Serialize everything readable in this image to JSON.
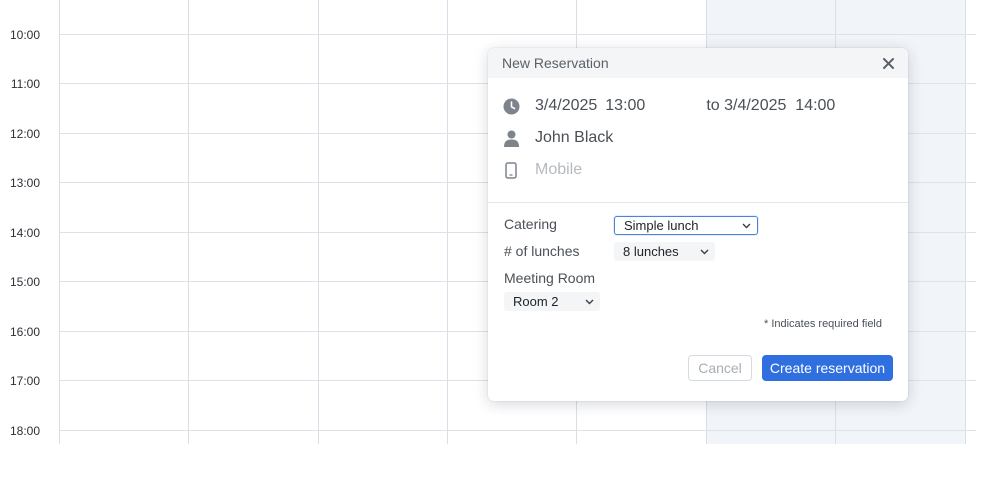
{
  "calendar": {
    "time_labels": [
      "10:00",
      "11:00",
      "12:00",
      "13:00",
      "14:00",
      "15:00",
      "16:00",
      "17:00",
      "18:00"
    ]
  },
  "dialog": {
    "title": "New Reservation",
    "start_date": "3/4/2025",
    "start_time": "13:00",
    "end_text": "to 3/4/2025  14:00",
    "person": "John Black",
    "mobile_placeholder": "Mobile",
    "catering_label": "Catering",
    "catering_value": "Simple lunch",
    "lunches_label": "# of lunches",
    "lunches_value": "8 lunches",
    "meeting_room_label": "Meeting Room",
    "meeting_room_value": "Room 2",
    "required_note": "* Indicates required field",
    "cancel_label": "Cancel",
    "create_label": "Create reservation"
  },
  "colors": {
    "accent": "#2f6fe0",
    "grid_line": "#d9dfe6",
    "weekend_shade": "#f1f4f8"
  }
}
